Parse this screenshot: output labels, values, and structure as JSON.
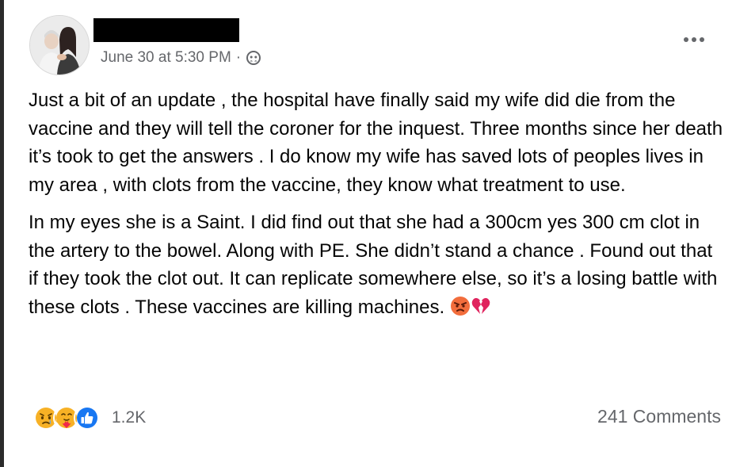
{
  "post": {
    "timestamp": "June 30 at 5:30 PM",
    "separator": "·",
    "privacy_icon": "friends-icon",
    "more_icon": "more-options-icon",
    "paragraphs": [
      "Just a bit of an update , the hospital have finally said my wife did die from the vaccine and they will tell the coroner for the inquest. Three months since her death it’s took to get the answers . I do know my wife has saved lots of peoples lives in my area , with clots from the vaccine, they know what treatment to use.",
      "In my eyes she is a Saint. I did find out that she had a 300cm yes 300 cm clot in the artery to the bowel. Along with PE. She didn’t stand a chance . Found out that if they took the clot out. It can replicate somewhere else, so it’s a losing battle with these clots . These vaccines are killing machines."
    ],
    "trailing_emojis": [
      "angry-emoji",
      "broken-heart-emoji"
    ]
  },
  "footer": {
    "reaction_icons": [
      "sad-reaction-icon",
      "care-reaction-icon",
      "like-reaction-icon"
    ],
    "reaction_count": "1.2K",
    "comments": "241 Comments"
  },
  "colors": {
    "text": "#050505",
    "secondary_text": "#65676b",
    "like_blue": "#1877f2",
    "reaction_yellow": "#f7b125"
  }
}
